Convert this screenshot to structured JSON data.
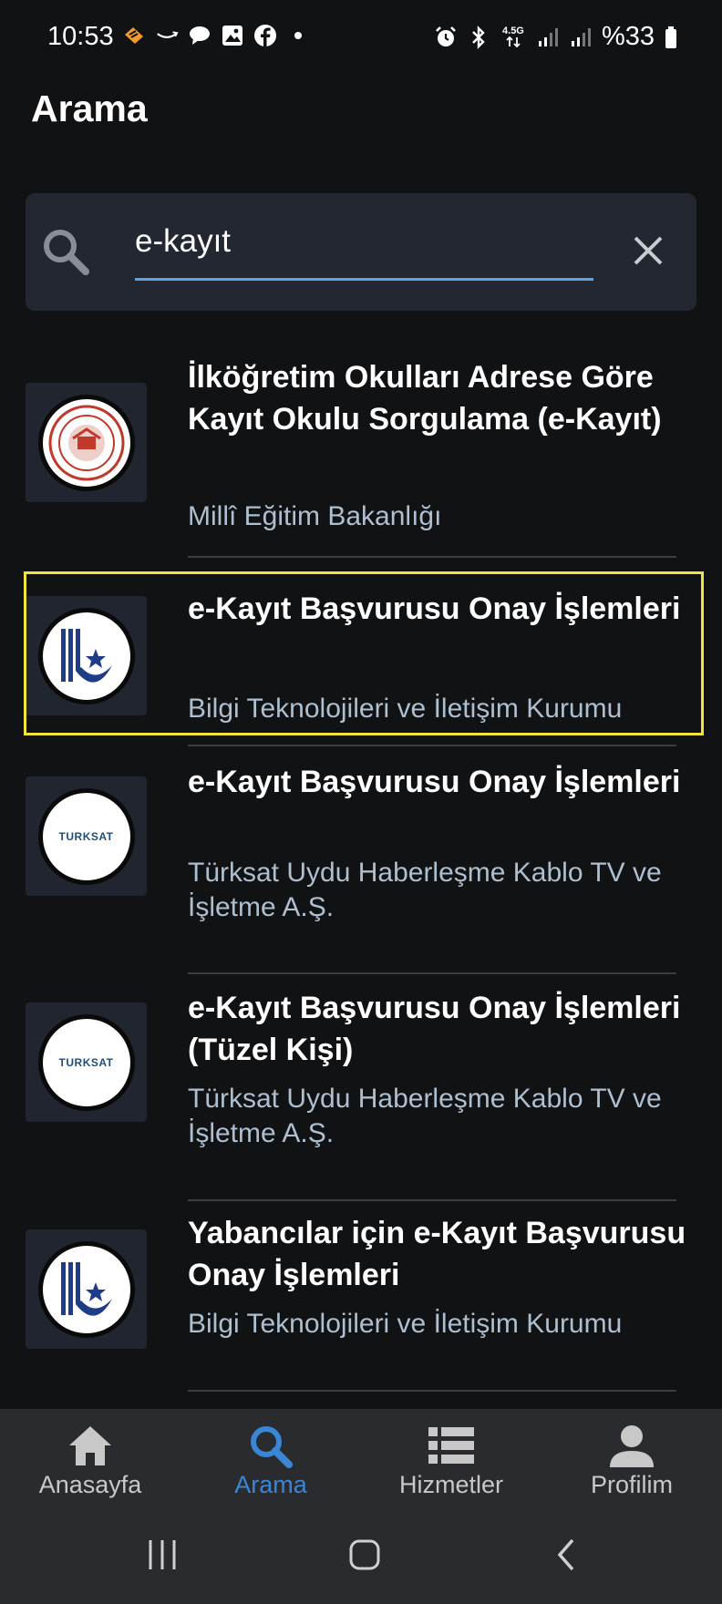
{
  "status": {
    "time": "10:53",
    "network": "4.5G",
    "battery": "%33"
  },
  "header": {
    "title": "Arama"
  },
  "search": {
    "value": "e-kayıt"
  },
  "results": [
    {
      "title": "İlköğretim Okulları Adrese Göre Kayıt Okulu Sorgulama (e-Kayıt)",
      "agency": "Millî Eğitim Bakanlığı",
      "logo": "meb-logo"
    },
    {
      "title": "e-Kayıt Başvurusu Onay İşlemleri",
      "agency": "Bilgi Teknolojileri ve İletişim Kurumu",
      "logo": "btk-logo"
    },
    {
      "title": "e-Kayıt Başvurusu Onay İşlemleri",
      "agency": "Türksat Uydu Haberleşme Kablo TV ve İşletme A.Ş.",
      "logo": "turksat-logo",
      "logo_text": "TURKSAT"
    },
    {
      "title": "e-Kayıt Başvurusu Onay İşlemleri (Tüzel Kişi)",
      "agency": "Türksat Uydu Haberleşme Kablo TV ve İşletme A.Ş.",
      "logo": "turksat-logo",
      "logo_text": "TURKSAT"
    },
    {
      "title": "Yabancılar için e-Kayıt Başvurusu Onay İşlemleri",
      "agency": "Bilgi Teknolojileri ve İletişim Kurumu",
      "logo": "btk-logo"
    }
  ],
  "nav": {
    "home": "Anasayfa",
    "search": "Arama",
    "services": "Hizmetler",
    "profile": "Profilim",
    "active": "search"
  },
  "colors": {
    "background": "#111214",
    "accent": "#3a86d6",
    "highlight": "#f1e43a",
    "subtitle": "#aebfd0"
  }
}
